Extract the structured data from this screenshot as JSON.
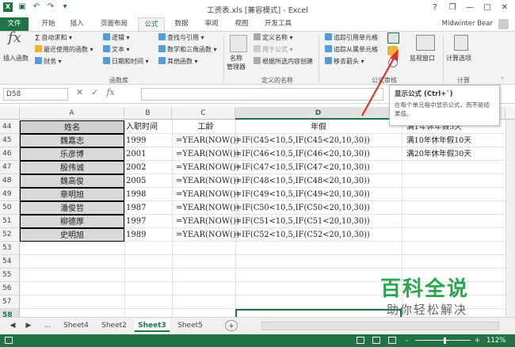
{
  "window": {
    "title": "工资表.xls  [兼容模式] - Excel",
    "user": "Midwinter Bear",
    "help": "?",
    "restore": "❐",
    "minimize": "—",
    "maximize": "□",
    "close": "✕"
  },
  "tabs": [
    "文件",
    "开始",
    "插入",
    "页面布局",
    "公式",
    "数据",
    "审阅",
    "视图",
    "开发工具"
  ],
  "active_tab": "公式",
  "ribbon": {
    "insert_function": "插入函数",
    "fx": "fx",
    "lib": {
      "autosum": "自动求和",
      "recent": "最近使用的函数",
      "financial": "财务",
      "logical": "逻辑",
      "text": "文本",
      "datetime": "日期和时间",
      "lookup": "查找与引用",
      "math": "数学和三角函数",
      "more": "其他函数",
      "group": "函数库"
    },
    "names": {
      "manager": "名称\n管理器",
      "define": "定义名称",
      "use": "用于公式",
      "create": "根据所选内容创建",
      "group": "定义的名称"
    },
    "audit": {
      "precedents": "追踪引用单元格",
      "dependents": "追踪从属单元格",
      "remove": "移去箭头",
      "group": "公式审核"
    },
    "watch": "监视窗口",
    "calc": {
      "options": "计算选项",
      "group": "计算"
    }
  },
  "tooltip": {
    "title": "显示公式 (Ctrl+`)",
    "body": "在每个单元格中显示公式，而不是结果值。"
  },
  "formula_bar": {
    "name_box": "D58",
    "cancel": "✕",
    "enter": "✓",
    "fx": "fx",
    "value": ""
  },
  "columns": [
    "A",
    "B",
    "C",
    "D",
    "E"
  ],
  "rows": [
    {
      "n": "44",
      "a": "姓名",
      "b": "入职时间",
      "c": "工龄",
      "d": "年假",
      "e": "满1年休年假5天",
      "header": true
    },
    {
      "n": "45",
      "a": "魏嘉志",
      "b": "1999",
      "c": "=YEAR(NOW())",
      "d": "=IF(C45<10,5,IF(C45<20,10,30))",
      "e": "满10年休年假10天"
    },
    {
      "n": "46",
      "a": "乐彦博",
      "b": "2001",
      "c": "=YEAR(NOW())",
      "d": "=IF(C46<10,5,IF(C46<20,10,30))",
      "e": "满20年休年假30天"
    },
    {
      "n": "47",
      "a": "殷伟诚",
      "b": "2002",
      "c": "=YEAR(NOW())",
      "d": "=IF(C47<10,5,IF(C47<20,10,30))",
      "e": ""
    },
    {
      "n": "48",
      "a": "魏高俊",
      "b": "2005",
      "c": "=YEAR(NOW())",
      "d": "=IF(C48<10,5,IF(C48<20,10,30))",
      "e": ""
    },
    {
      "n": "49",
      "a": "章明旭",
      "b": "1998",
      "c": "=YEAR(NOW())",
      "d": "=IF(C49<10,5,IF(C49<20,10,30))",
      "e": ""
    },
    {
      "n": "50",
      "a": "潘俊哲",
      "b": "1987",
      "c": "=YEAR(NOW())",
      "d": "=IF(C50<10,5,IF(C50<20,10,30))",
      "e": ""
    },
    {
      "n": "51",
      "a": "柳德厚",
      "b": "1997",
      "c": "=YEAR(NOW())",
      "d": "=IF(C51<10,5,IF(C51<20,10,30))",
      "e": ""
    },
    {
      "n": "52",
      "a": "史明旭",
      "b": "1989",
      "c": "=YEAR(NOW())",
      "d": "=IF(C52<10,5,IF(C52<20,10,30))",
      "e": ""
    },
    {
      "n": "53",
      "a": "",
      "b": "",
      "c": "",
      "d": "",
      "e": ""
    },
    {
      "n": "54",
      "a": "",
      "b": "",
      "c": "",
      "d": "",
      "e": ""
    },
    {
      "n": "55",
      "a": "",
      "b": "",
      "c": "",
      "d": "",
      "e": ""
    },
    {
      "n": "56",
      "a": "",
      "b": "",
      "c": "",
      "d": "",
      "e": ""
    },
    {
      "n": "57",
      "a": "",
      "b": "",
      "c": "",
      "d": "",
      "e": ""
    },
    {
      "n": "58",
      "a": "",
      "b": "",
      "c": "",
      "d": "",
      "e": ""
    }
  ],
  "sheets": [
    "Sheet4",
    "Sheet2",
    "Sheet3",
    "Sheet5"
  ],
  "active_sheet": "Sheet3",
  "sheet_nav": {
    "prev": "◀",
    "next": "▶",
    "more": "...",
    "add": "+"
  },
  "status": {
    "zoom": "112%",
    "minus": "-",
    "plus": "+"
  },
  "watermark": {
    "line1": "百科全说",
    "line2": "助你轻松解决"
  },
  "colors": {
    "accent": "#217346",
    "arrow": "#d9342b",
    "watermark": "#2aa64c"
  }
}
